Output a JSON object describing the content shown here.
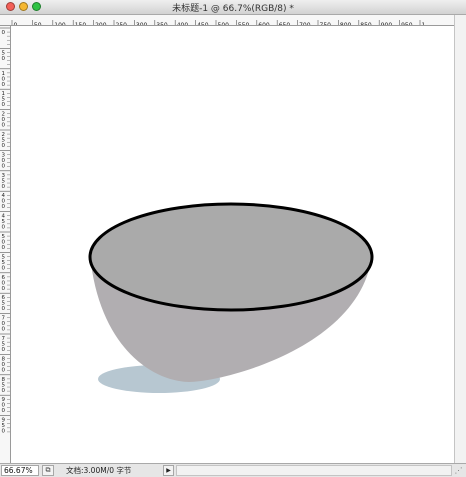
{
  "window": {
    "title": "未标题-1 @ 66.7%(RGB/8) *"
  },
  "ruler": {
    "top_labels": [
      "0",
      "50",
      "100",
      "150",
      "200",
      "250",
      "300",
      "350",
      "400",
      "450",
      "500",
      "550",
      "600",
      "650",
      "700",
      "750",
      "800",
      "850",
      "900",
      "950",
      "1"
    ],
    "left_labels": [
      "0",
      "5\n0",
      "1\n0\n0",
      "1\n5\n0",
      "2\n0\n0",
      "2\n5\n0",
      "3\n0\n0",
      "3\n5\n0",
      "4\n0\n0",
      "4\n5\n0",
      "5\n0\n0",
      "5\n5\n0",
      "6\n0\n0",
      "6\n5\n0",
      "7\n0\n0",
      "7\n5\n0",
      "8\n0\n0",
      "8\n5\n0",
      "9\n0\n0",
      "9\n5\n0"
    ]
  },
  "artwork": {
    "bowl_body_color": "#b1aeb1",
    "bowl_inner_color": "#aaaaaa",
    "bowl_rim_color": "#000000",
    "bowl_foot_color": "#b7c7d1"
  },
  "status": {
    "zoom": "66.67%",
    "doc_info": "文档:3.00M/0 字节",
    "menu_arrow": "▶"
  },
  "icons": {
    "close": "close-icon",
    "minimize": "minimize-icon",
    "zoom": "zoom-icon",
    "status_toggle": "status-toggle-icon",
    "resize_grip": "resize-grip-icon"
  }
}
